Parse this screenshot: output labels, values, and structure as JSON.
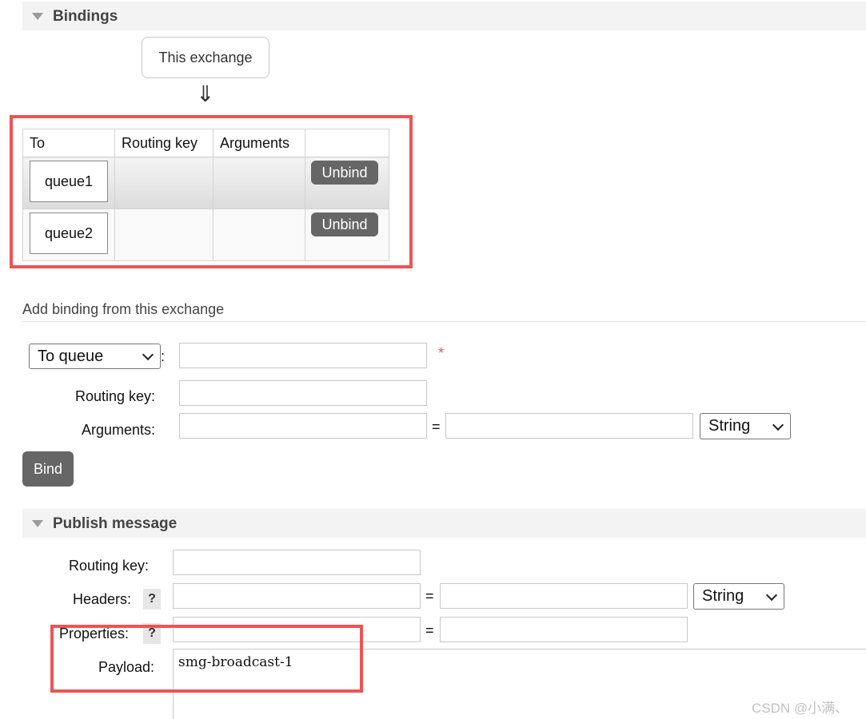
{
  "bindings_section": {
    "title": "Bindings",
    "this_exchange_label": "This exchange",
    "arrow_glyph": "⇓",
    "table": {
      "headers": [
        "To",
        "Routing key",
        "Arguments",
        ""
      ],
      "rows": [
        {
          "to": "queue1",
          "routing_key": "",
          "arguments": "",
          "action": "Unbind"
        },
        {
          "to": "queue2",
          "routing_key": "",
          "arguments": "",
          "action": "Unbind"
        }
      ]
    }
  },
  "add_binding": {
    "heading": "Add binding from this exchange",
    "destination_select": "To queue",
    "colon": ":",
    "required_mark": "*",
    "routing_key_label": "Routing key:",
    "arguments_label": "Arguments:",
    "equals": "=",
    "arguments_type": "String",
    "bind_button": "Bind"
  },
  "publish_section": {
    "title": "Publish message",
    "routing_key_label": "Routing key:",
    "headers_label": "Headers:",
    "properties_label": "Properties:",
    "help_glyph": "?",
    "equals": "=",
    "headers_type": "String",
    "payload_label": "Payload:",
    "payload_value": "smg-broadcast-1"
  },
  "watermark": "CSDN @小满、",
  "colors": {
    "highlight_red": "#ef5354",
    "button_gray": "#666666",
    "header_bg": "#f3f3f3"
  }
}
